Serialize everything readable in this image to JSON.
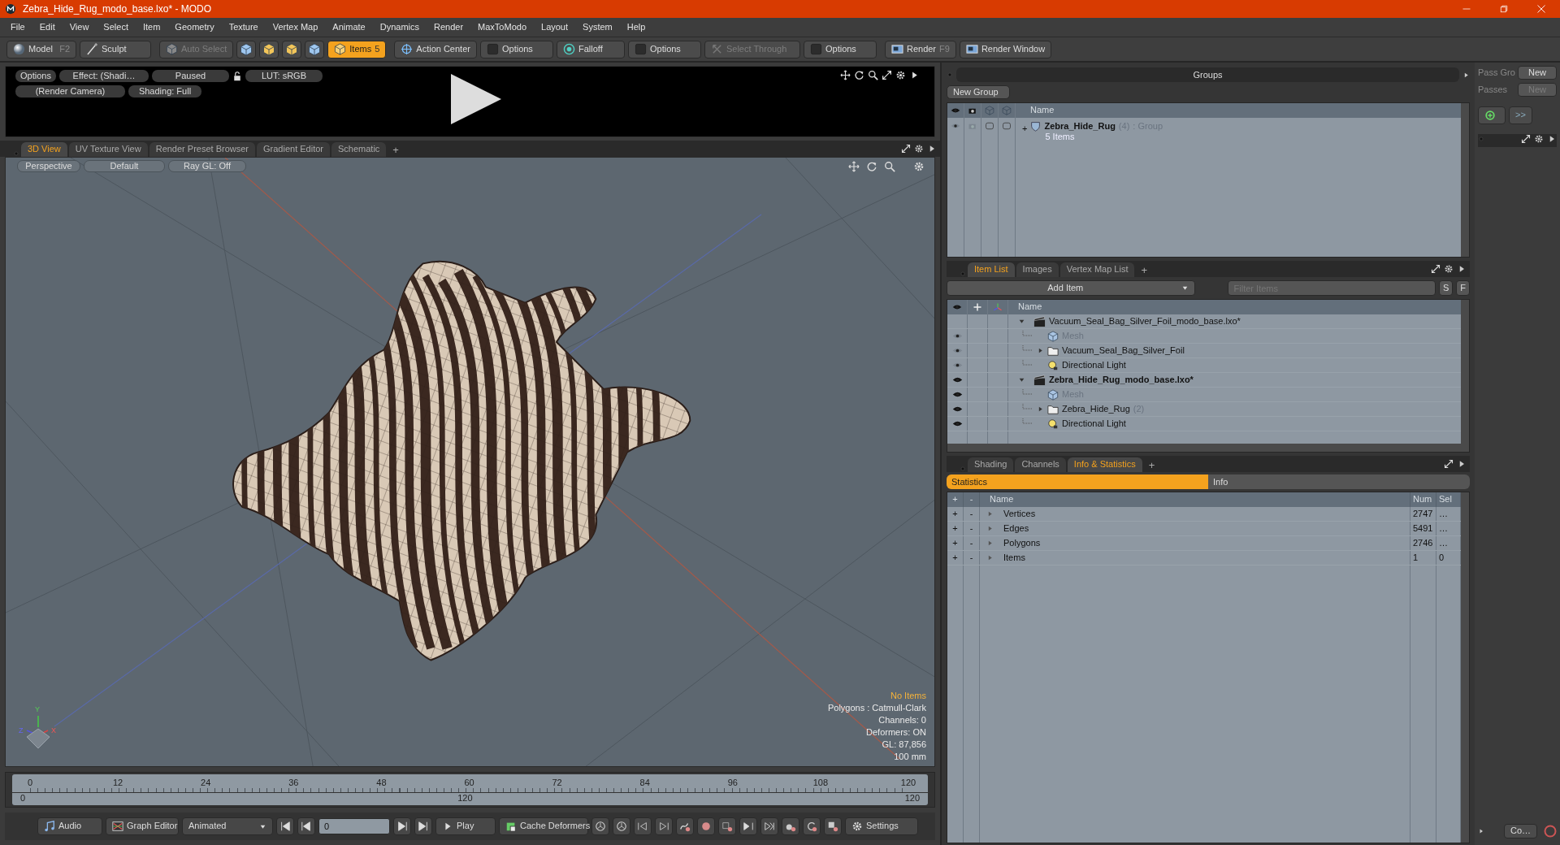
{
  "window": {
    "title": "Zebra_Hide_Rug_modo_base.lxo* - MODO"
  },
  "menu": [
    "File",
    "Edit",
    "View",
    "Select",
    "Item",
    "Geometry",
    "Texture",
    "Vertex Map",
    "Animate",
    "Dynamics",
    "Render",
    "MaxToModo",
    "Layout",
    "System",
    "Help"
  ],
  "toolbar": [
    {
      "label": "Model",
      "shortcut": "F2",
      "selected": false,
      "disabled": false
    },
    {
      "label": "Sculpt",
      "selected": false,
      "disabled": false
    },
    {
      "label": "Auto Select",
      "selected": false,
      "disabled": true
    },
    {
      "label": "Items",
      "shortcut": "5",
      "selected": true,
      "disabled": false
    },
    {
      "label": "Action Center",
      "selected": false,
      "disabled": false
    },
    {
      "label": "Options",
      "selected": false,
      "disabled": false
    },
    {
      "label": "Falloff",
      "selected": false,
      "disabled": false
    },
    {
      "label": "Options",
      "selected": false,
      "disabled": false
    },
    {
      "label": "Select Through",
      "selected": false,
      "disabled": true
    },
    {
      "label": "Options",
      "selected": false,
      "disabled": false
    },
    {
      "label": "Render",
      "shortcut": "F9",
      "selected": false,
      "disabled": false
    },
    {
      "label": "Render Window",
      "selected": false,
      "disabled": false
    }
  ],
  "render_preview": {
    "options": "Options",
    "effect": "Effect: (Shadi…",
    "status": "Paused",
    "lut": "LUT: sRGB",
    "camera": "(Render Camera)",
    "shading": "Shading: Full"
  },
  "viewport_tabs": [
    {
      "label": "3D View",
      "selected": true
    },
    {
      "label": "UV Texture View",
      "selected": false
    },
    {
      "label": "Render Preset Browser",
      "selected": false
    },
    {
      "label": "Gradient Editor",
      "selected": false
    },
    {
      "label": "Schematic",
      "selected": false
    }
  ],
  "viewport_add_tab": "+",
  "viewport": {
    "buttons": [
      "Perspective",
      "Default",
      "Ray GL: Off"
    ],
    "axis_labels": [
      "Y",
      "X",
      "Z"
    ],
    "info": [
      {
        "text": "No Items",
        "kind": "highlight"
      },
      {
        "text": "Polygons : Catmull-Clark",
        "kind": "plain"
      },
      {
        "text": "Channels: 0",
        "kind": "plain"
      },
      {
        "text": "Deformers: ON",
        "kind": "plain"
      },
      {
        "text": "GL: 87,856",
        "kind": "plain"
      },
      {
        "text": "100 mm",
        "kind": "plain"
      }
    ]
  },
  "timeline": {
    "ticks": [
      "0",
      "12",
      "24",
      "36",
      "48",
      "60",
      "72",
      "84",
      "96",
      "108",
      "120"
    ],
    "range_start": "0",
    "range_mid": "120",
    "range_end": "120"
  },
  "bottom_bar": {
    "audio": "Audio",
    "graph_editor": "Graph Editor",
    "mode": "Animated",
    "frame": "0",
    "play": "Play",
    "cache": "Cache Deformers",
    "settings": "Settings"
  },
  "groups": {
    "title": "Groups",
    "new_group": "New Group",
    "name_column": "Name",
    "rows": [
      {
        "name": "Zebra_Hide_Rug",
        "count": "(4)",
        "type": ": Group",
        "items": "5 Items",
        "expand": "+"
      }
    ]
  },
  "passes": {
    "group_label": "Pass Gro",
    "group_button": {
      "label": "New",
      "disabled": false
    },
    "passes_label": "Passes",
    "passes_button": {
      "label": "New",
      "disabled": true
    },
    "more": ">>",
    "bottom_button": "Co…"
  },
  "item_list": {
    "tabs": [
      {
        "label": "Item List",
        "selected": true
      },
      {
        "label": "Images",
        "selected": false
      },
      {
        "label": "Vertex Map List",
        "selected": false
      }
    ],
    "add_tab": "+",
    "add_item": "Add Item",
    "filter_placeholder": "Filter Items",
    "s_button": "S",
    "f_button": "F",
    "name_column": "Name",
    "scenes": [
      {
        "name": "Vacuum_Seal_Bag_Silver_Foil_modo_base.lxo*",
        "current": false,
        "expanded": true,
        "children": [
          {
            "kind": "mesh",
            "name": "Mesh",
            "visible": false
          },
          {
            "kind": "group",
            "name": "Vacuum_Seal_Bag_Silver_Foil",
            "visible": false
          },
          {
            "kind": "light",
            "name": "Directional Light",
            "visible": false
          }
        ]
      },
      {
        "name": "Zebra_Hide_Rug_modo_base.lxo*",
        "current": true,
        "expanded": true,
        "children": [
          {
            "kind": "mesh",
            "name": "Mesh",
            "visible": true
          },
          {
            "kind": "group",
            "name": "Zebra_Hide_Rug",
            "count": "(2)",
            "visible": true
          },
          {
            "kind": "light",
            "name": "Directional Light",
            "visible": true
          }
        ]
      }
    ]
  },
  "stats": {
    "tabs": [
      {
        "label": "Shading",
        "selected": false
      },
      {
        "label": "Channels",
        "selected": false
      },
      {
        "label": "Info & Statistics",
        "selected": true
      }
    ],
    "add_tab": "+",
    "subtabs": [
      {
        "label": "Statistics",
        "selected": true
      },
      {
        "label": "Info",
        "selected": false
      }
    ],
    "columns": [
      "+",
      "-",
      "Name",
      "Num",
      "Sel"
    ],
    "rows": [
      {
        "plus": "+",
        "minus": "-",
        "name": "Vertices",
        "num": "2747",
        "sel": "…"
      },
      {
        "plus": "+",
        "minus": "-",
        "name": "Edges",
        "num": "5491",
        "sel": "…"
      },
      {
        "plus": "+",
        "minus": "-",
        "name": "Polygons",
        "num": "2746",
        "sel": "…"
      },
      {
        "plus": "+",
        "minus": "-",
        "name": "Items",
        "num": "1",
        "sel": "0"
      }
    ]
  }
}
